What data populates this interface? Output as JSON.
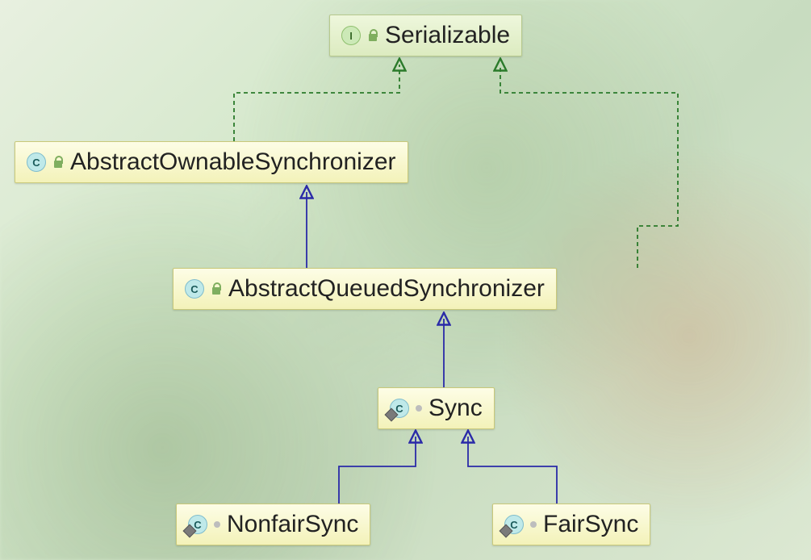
{
  "nodes": {
    "serializable": {
      "label": "Serializable",
      "kind": "interface",
      "badge": "I"
    },
    "aos": {
      "label": "AbstractOwnableSynchronizer",
      "kind": "class",
      "badge": "C"
    },
    "aqs": {
      "label": "AbstractQueuedSynchronizer",
      "kind": "class",
      "badge": "C"
    },
    "sync": {
      "label": "Sync",
      "kind": "static-class",
      "badge": "C"
    },
    "nonfair": {
      "label": "NonfairSync",
      "kind": "static-class",
      "badge": "C"
    },
    "fair": {
      "label": "FairSync",
      "kind": "static-class",
      "badge": "C"
    }
  },
  "edges": [
    {
      "from": "aos",
      "to": "serializable",
      "type": "implements"
    },
    {
      "from": "aqs",
      "to": "serializable",
      "type": "implements"
    },
    {
      "from": "aqs",
      "to": "aos",
      "type": "extends"
    },
    {
      "from": "sync",
      "to": "aqs",
      "type": "extends"
    },
    {
      "from": "nonfair",
      "to": "sync",
      "type": "extends"
    },
    {
      "from": "fair",
      "to": "sync",
      "type": "extends"
    }
  ],
  "colors": {
    "extends": "#2a2aa8",
    "implements": "#2a7a2a"
  }
}
